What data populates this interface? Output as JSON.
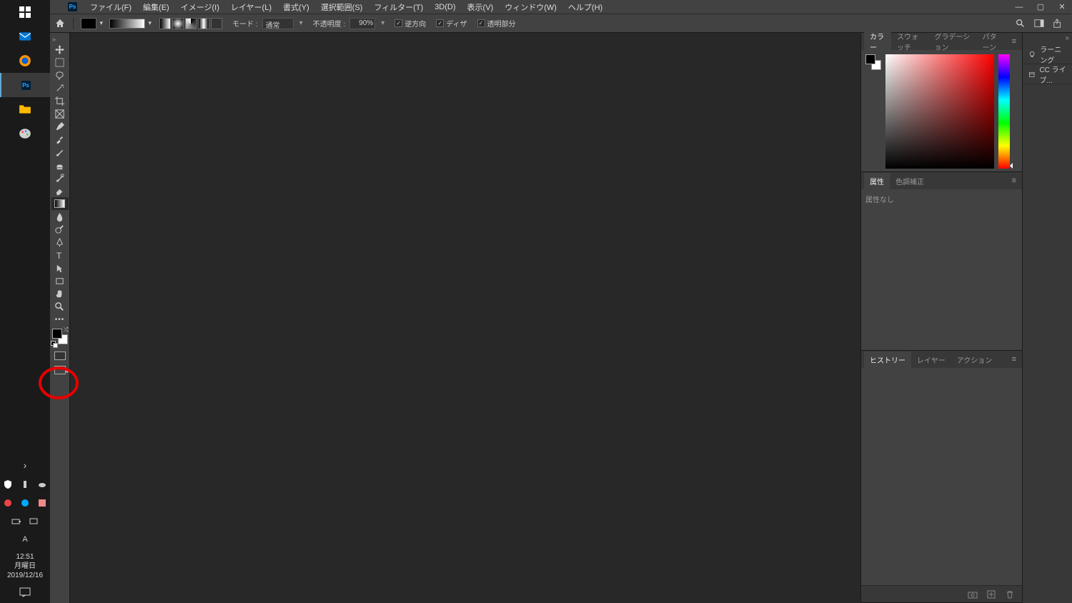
{
  "taskbar": {
    "time": "12:51",
    "day": "月曜日",
    "date": "2019/12/16"
  },
  "menu": {
    "file": "ファイル(F)",
    "edit": "編集(E)",
    "image": "イメージ(I)",
    "layer": "レイヤー(L)",
    "type": "書式(Y)",
    "select": "選択範囲(S)",
    "filter": "フィルター(T)",
    "3d": "3D(D)",
    "view": "表示(V)",
    "window": "ウィンドウ(W)",
    "help": "ヘルプ(H)"
  },
  "options": {
    "mode_label": "モード :",
    "mode_value": "通常",
    "opacity_label": "不透明度 :",
    "opacity_value": "90%",
    "reverse": "逆方向",
    "dither": "ディザ",
    "transparency": "透明部分"
  },
  "panels": {
    "color": "カラー",
    "swatches": "スウォッチ",
    "gradients": "グラデーション",
    "patterns": "パターン",
    "properties": "属性",
    "adjustments": "色調補正",
    "no_properties": "属性なし",
    "history": "ヒストリー",
    "layers": "レイヤー",
    "actions": "アクション"
  },
  "right_strip": {
    "learning": "ラーニング",
    "cc_libs": "CC ライブ..."
  },
  "tools": {
    "move": "move-tool",
    "marquee": "marquee-tool",
    "lasso": "lasso-tool",
    "magic_wand": "magic-wand-tool",
    "crop": "crop-tool",
    "frame": "frame-tool",
    "eyedropper": "eyedropper-tool",
    "healing": "healing-brush-tool",
    "brush": "brush-tool",
    "clone": "clone-stamp-tool",
    "history_brush": "history-brush-tool",
    "eraser": "eraser-tool",
    "gradient": "gradient-tool",
    "blur": "blur-tool",
    "dodge": "dodge-tool",
    "pen": "pen-tool",
    "text": "text-tool",
    "path_select": "path-selection-tool",
    "shape": "shape-tool",
    "hand": "hand-tool",
    "zoom": "zoom-tool"
  }
}
